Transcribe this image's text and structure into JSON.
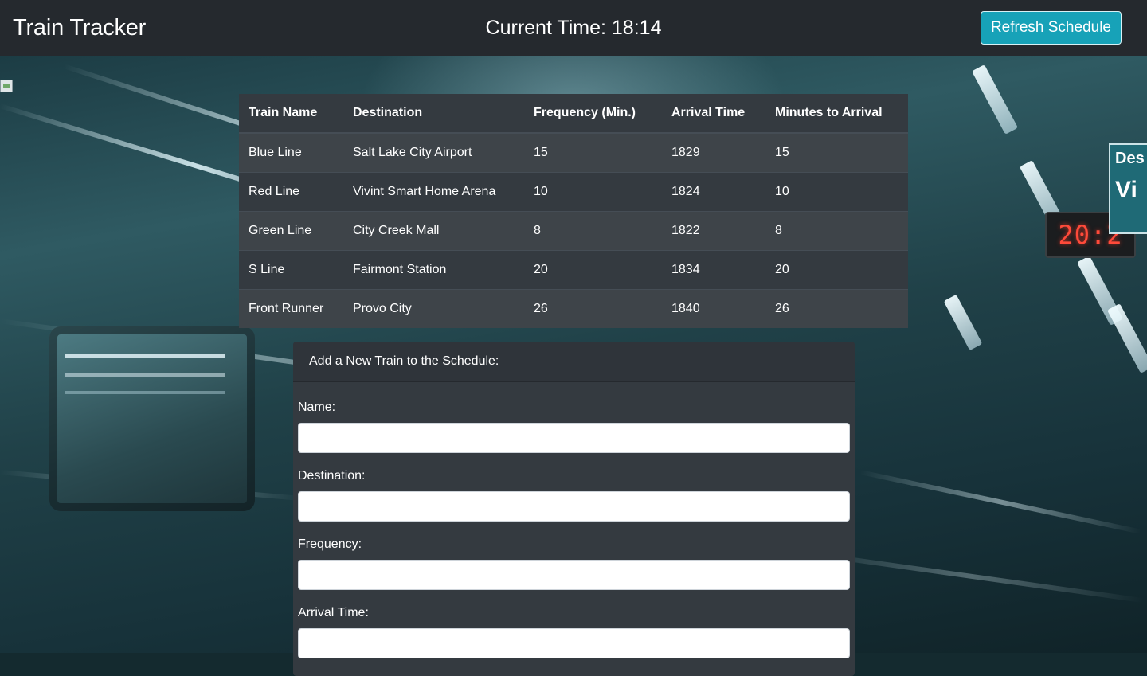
{
  "header": {
    "title": "Train Tracker",
    "clock_label": "Current Time: 18:14",
    "refresh_label": "Refresh Schedule"
  },
  "background": {
    "led_display": "20:2",
    "sign_line1": "Des",
    "sign_line2": "Vi"
  },
  "schedule": {
    "columns": [
      "Train Name",
      "Destination",
      "Frequency (Min.)",
      "Arrival Time",
      "Minutes to Arrival"
    ],
    "rows": [
      [
        "Blue Line",
        "Salt Lake City Airport",
        "15",
        "1829",
        "15"
      ],
      [
        "Red Line",
        "Vivint Smart Home Arena",
        "10",
        "1824",
        "10"
      ],
      [
        "Green Line",
        "City Creek Mall",
        "8",
        "1822",
        "8"
      ],
      [
        "S Line",
        "Fairmont Station",
        "20",
        "1834",
        "20"
      ],
      [
        "Front Runner",
        "Provo City",
        "26",
        "1840",
        "26"
      ]
    ]
  },
  "form": {
    "title": "Add a New Train to the Schedule:",
    "fields": [
      {
        "label": "Name:",
        "value": ""
      },
      {
        "label": "Destination:",
        "value": ""
      },
      {
        "label": "Frequency:",
        "value": ""
      },
      {
        "label": "Arrival Time:",
        "value": ""
      }
    ]
  },
  "colors": {
    "navbar": "#25292e",
    "table": "#343a40",
    "accent": "#17a2b8",
    "led": "#ff4a3a"
  }
}
